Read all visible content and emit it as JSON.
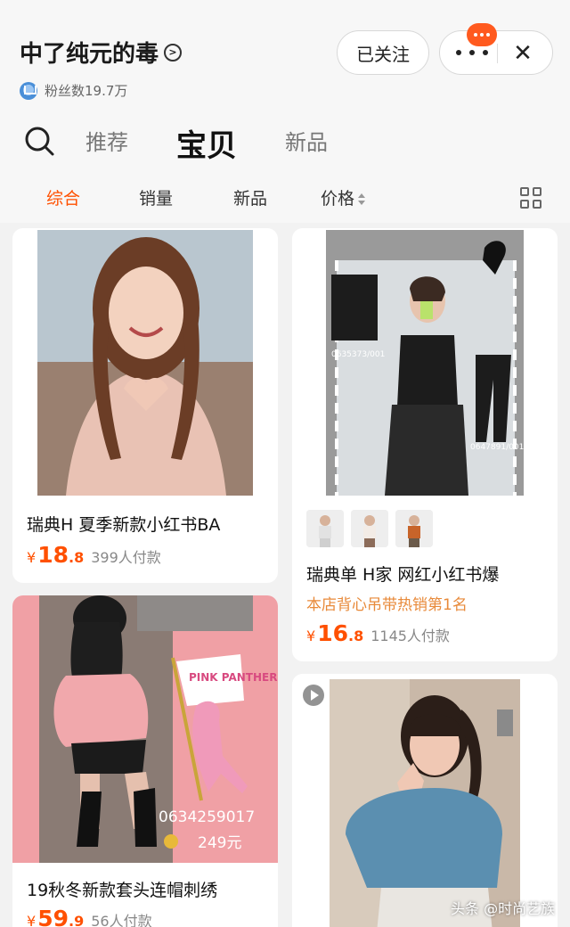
{
  "shop": {
    "name": "中了纯元的毒",
    "fans_label": "粉丝数19.7万",
    "follow_label": "已关注",
    "close_label": "✕"
  },
  "tabs": [
    {
      "label": "推荐"
    },
    {
      "label": "宝贝"
    },
    {
      "label": "新品"
    }
  ],
  "sort": {
    "items": [
      "综合",
      "销量",
      "新品",
      "价格"
    ],
    "active": "综合"
  },
  "colors": {
    "accent": "#ff5000",
    "promo": "#e88a3a",
    "badge": "#ff5a1f"
  },
  "icons": [
    "search-icon",
    "chevron-right-icon",
    "more-icon",
    "close-icon",
    "grid-view-icon",
    "crown-icon",
    "play-icon"
  ],
  "products": [
    {
      "title": "瑞典H 夏季新款小红书BA",
      "price_int": "18",
      "price_dec": ".8",
      "currency": "¥",
      "sold": "399人付款"
    },
    {
      "title": "瑞典单 H家 网红小红书爆",
      "promo": "本店背心吊带热销第1名",
      "price_int": "16",
      "price_dec": ".8",
      "currency": "¥",
      "sold": "1145人付款",
      "image_text": {
        "code1": "0635373/001",
        "code2": "0647891/001"
      }
    },
    {
      "title": "19秋冬新款套头连帽刺绣",
      "price_int": "59",
      "price_dec": ".9",
      "currency": "¥",
      "sold": "56人付款",
      "image_text": {
        "flag": "PINK PANTHER",
        "phone": "0634259017",
        "price_tag": "249元"
      }
    },
    {
      "title": ""
    }
  ],
  "watermark": "头条 @时尚艺族"
}
